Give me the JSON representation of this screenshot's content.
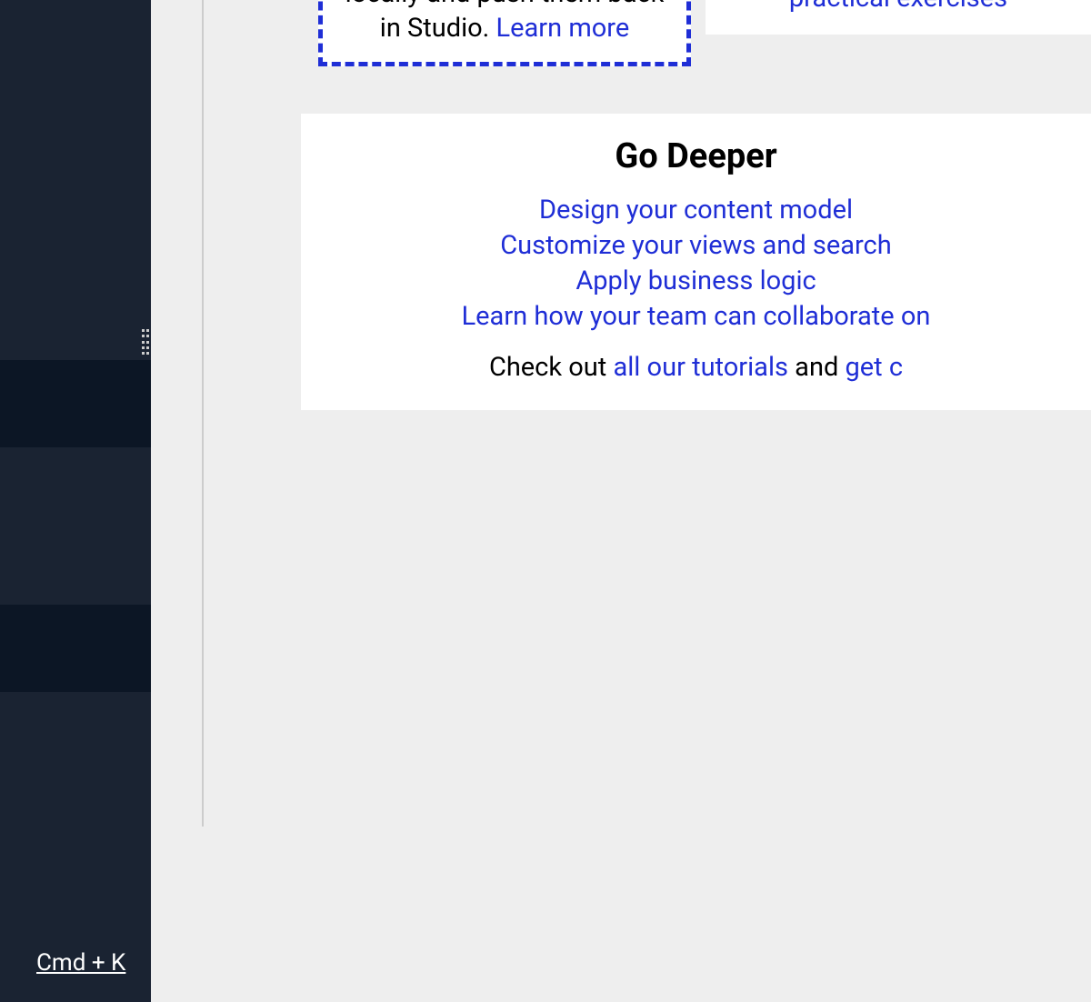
{
  "sidebar": {
    "keybind": "Cmd + K"
  },
  "cardDashed": {
    "text_prefix": "locally and push them back in Studio. ",
    "learn_more": "Learn more"
  },
  "cardSide": {
    "link": "practical exercises"
  },
  "goDeeper": {
    "heading": "Go Deeper",
    "links": {
      "link1": "Design your content model",
      "link2": "Customize your views and search",
      "link3": "Apply business logic",
      "link4": "Learn how your team can collaborate on"
    },
    "footer": {
      "prefix": "Check out ",
      "tutorials": "all our tutorials",
      "and": " and ",
      "getc": "get c"
    }
  }
}
